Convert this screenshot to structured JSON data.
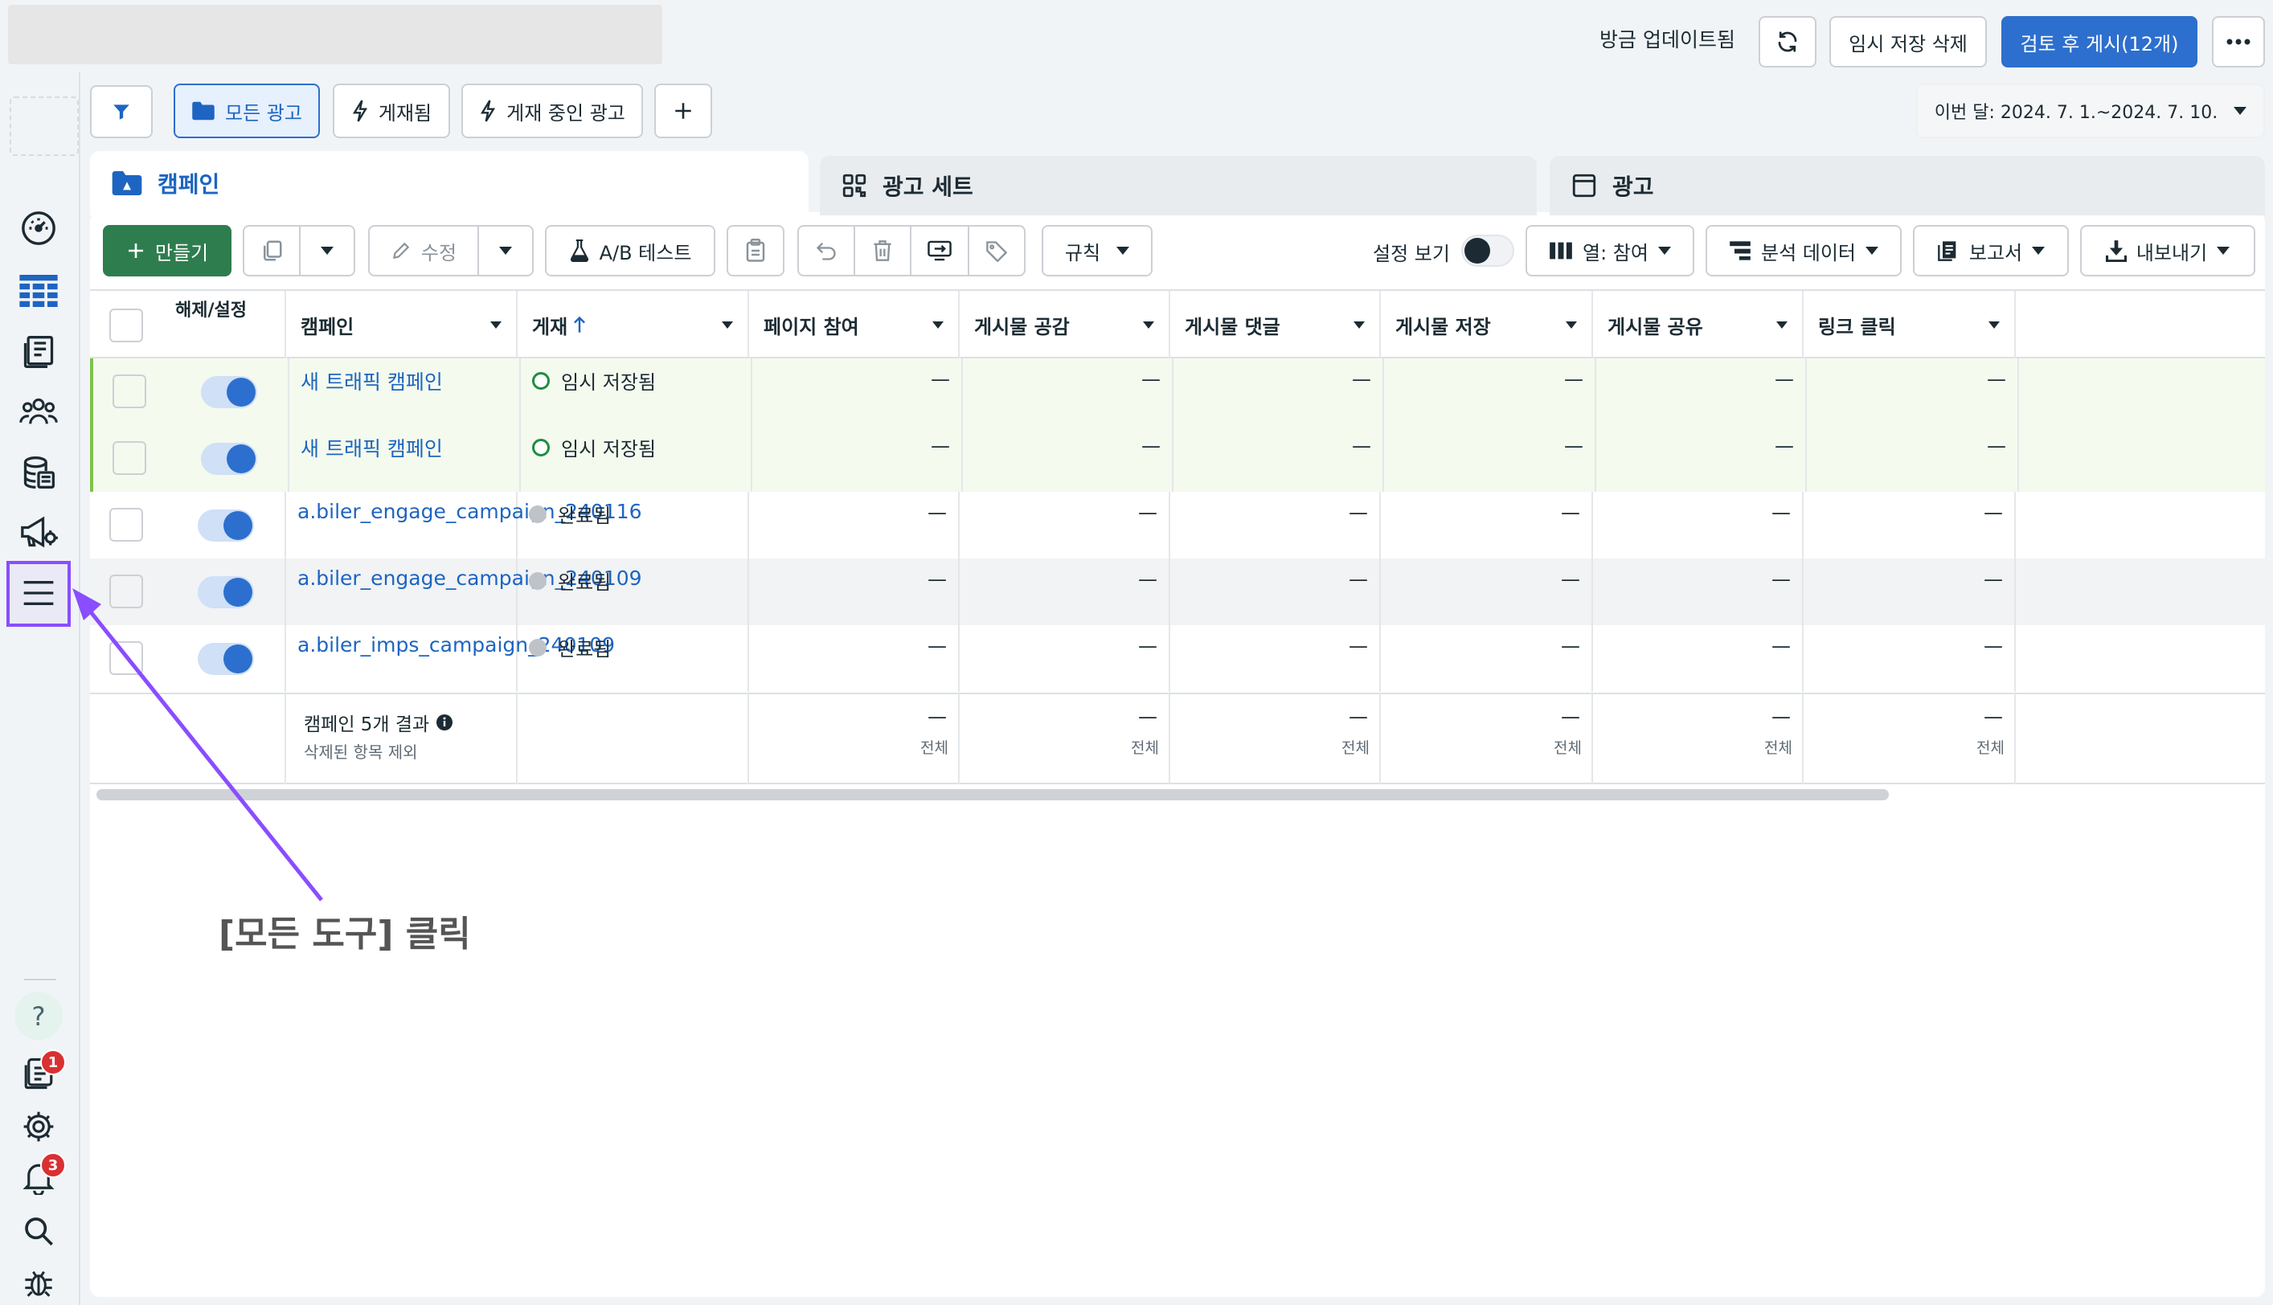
{
  "header": {
    "status": "방금 업데이트됨",
    "delete_draft": "임시 저장 삭제",
    "review_publish": "검토 후 게시(12개)"
  },
  "filters": {
    "all_ads": "모든 광고",
    "published": "게재됨",
    "active_ads": "게재 중인 광고",
    "date_range": "이번 달: 2024. 7. 1.~2024. 7. 10."
  },
  "tabs": {
    "campaign": "캠페인",
    "adset": "광고 세트",
    "ad": "광고"
  },
  "toolbar": {
    "create": "만들기",
    "edit": "수정",
    "ab_test": "A/B 테스트",
    "rules": "규칙",
    "view_settings": "설정 보기",
    "columns": "열: 참여",
    "breakdown": "분석 데이터",
    "reports": "보고서",
    "export": "내보내기"
  },
  "table": {
    "headers": [
      "해제/설정",
      "캠페인",
      "게재",
      "페이지 참여",
      "게시물 공감",
      "게시물 댓글",
      "게시물 저장",
      "게시물 공유",
      "링크 클릭"
    ],
    "rows": [
      {
        "name": "새 트래픽 캠페인",
        "status": "임시 저장됨",
        "status_type": "draft",
        "values": [
          "—",
          "—",
          "—",
          "—",
          "—",
          "—"
        ]
      },
      {
        "name": "새 트래픽 캠페인",
        "status": "임시 저장됨",
        "status_type": "draft",
        "values": [
          "—",
          "—",
          "—",
          "—",
          "—",
          "—"
        ]
      },
      {
        "name": "a.biler_engage_campaign_240116",
        "status": "완료됨",
        "status_type": "completed",
        "values": [
          "—",
          "—",
          "—",
          "—",
          "—",
          "—"
        ]
      },
      {
        "name": "a.biler_engage_campaign_240109",
        "status": "완료됨",
        "status_type": "completed",
        "values": [
          "—",
          "—",
          "—",
          "—",
          "—",
          "—"
        ]
      },
      {
        "name": "a.biler_imps_campaign_240109",
        "status": "완료됨",
        "status_type": "completed",
        "values": [
          "—",
          "—",
          "—",
          "—",
          "—",
          "—"
        ]
      }
    ],
    "summary": {
      "title": "캠페인 5개 결과",
      "subtitle": "삭제된 항목 제외",
      "value": "—",
      "total_label": "전체"
    }
  },
  "sidebar": {
    "badge_ads": "1",
    "badge_notifications": "3"
  },
  "annotation": {
    "text": "[모든 도구] 클릭"
  },
  "colors": {
    "primary": "#2d6fce",
    "create": "#2e7d4f",
    "link": "#1d65c1",
    "annotation": "#8a4dff"
  }
}
